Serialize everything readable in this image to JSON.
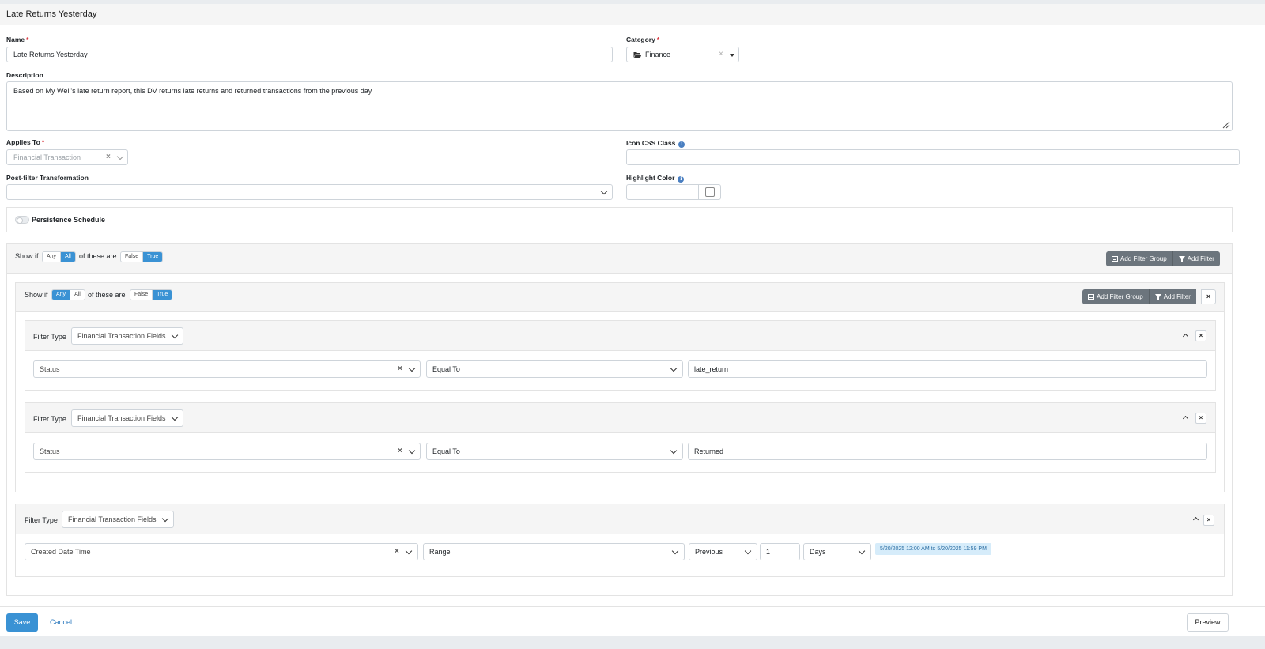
{
  "header": {
    "title": "Late Returns Yesterday"
  },
  "form": {
    "name": {
      "label": "Name",
      "required_mark": "*",
      "value": "Late Returns Yesterday"
    },
    "category": {
      "label": "Category",
      "required_mark": "*",
      "value": "Finance",
      "icon": "folder-open-icon"
    },
    "description": {
      "label": "Description",
      "value": "Based on My Well's late return report, this DV returns late returns and returned transactions from the previous day"
    },
    "applies_to": {
      "label": "Applies To",
      "required_mark": "*",
      "value": "Financial Transaction"
    },
    "icon_css_class": {
      "label": "Icon CSS Class",
      "value": ""
    },
    "post_filter": {
      "label": "Post-filter Transformation",
      "value": ""
    },
    "highlight_color": {
      "label": "Highlight Color",
      "value": ""
    },
    "persistence": {
      "label": "Persistence Schedule",
      "enabled": false
    }
  },
  "outer_group": {
    "show_if": "Show if",
    "of_these_are": "of these are",
    "match_options": [
      "Any",
      "All"
    ],
    "match_selected": "All",
    "truth_options": [
      "False",
      "True"
    ],
    "truth_selected": "True",
    "add_group_label": "Add Filter Group",
    "add_filter_label": "Add Filter"
  },
  "inner_group": {
    "show_if": "Show if",
    "of_these_are": "of these are",
    "match_options": [
      "Any",
      "All"
    ],
    "match_selected": "Any",
    "truth_options": [
      "False",
      "True"
    ],
    "truth_selected": "True",
    "add_group_label": "Add Filter Group",
    "add_filter_label": "Add Filter",
    "close": "×"
  },
  "filters": [
    {
      "type_label": "Filter Type",
      "type_value": "Financial Transaction Fields",
      "field": "Status",
      "operator": "Equal To",
      "value": "late_return"
    },
    {
      "type_label": "Filter Type",
      "type_value": "Financial Transaction Fields",
      "field": "Status",
      "operator": "Equal To",
      "value": "Returned"
    },
    {
      "type_label": "Filter Type",
      "type_value": "Financial Transaction Fields",
      "field": "Created Date Time",
      "operator": "Range",
      "range_mode": "Previous",
      "range_count": "1",
      "range_unit": "Days",
      "range_text": "5/20/2025 12:00 AM to 5/20/2025 11:59 PM"
    }
  ],
  "footer": {
    "save": "Save",
    "cancel": "Cancel",
    "preview": "Preview"
  },
  "colors": {
    "accent": "#3a92d4",
    "dark_button": "#6c757d",
    "required": "#d9363e",
    "badge_bg": "#d6ecfa"
  }
}
